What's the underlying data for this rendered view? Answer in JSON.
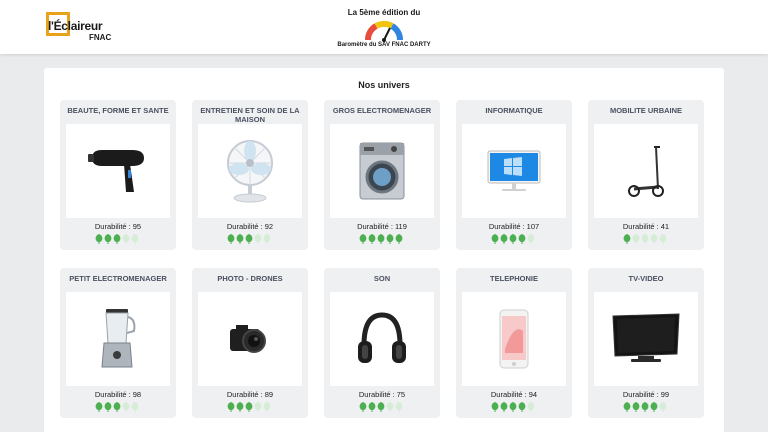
{
  "header": {
    "logo_line1": "l'Éclaireur",
    "logo_line2": "FNAC",
    "barometer_edition": "La 5ème édition du",
    "barometer_title": "Baromètre du SAV FNAC DARTY"
  },
  "main": {
    "title": "Nos univers",
    "durability_label": "Durabilité :",
    "colors": {
      "leaf_on": "#4caf50",
      "leaf_off": "#d6ecd7",
      "brand": "#e8a21b"
    },
    "cards": [
      {
        "title": "BEAUTE, FORME ET SANTE",
        "durability": "95",
        "score": 3,
        "icon": "hair-dryer-icon"
      },
      {
        "title": "ENTRETIEN ET SOIN DE LA MAISON",
        "durability": "92",
        "score": 3,
        "icon": "fan-icon"
      },
      {
        "title": "GROS ELECTROMENAGER",
        "durability": "119",
        "score": 5,
        "icon": "washing-machine-icon"
      },
      {
        "title": "INFORMATIQUE",
        "durability": "107",
        "score": 4,
        "icon": "desktop-computer-icon"
      },
      {
        "title": "MOBILITE URBAINE",
        "durability": "41",
        "score": 1,
        "icon": "scooter-icon"
      },
      {
        "title": "PETIT ELECTROMENAGER",
        "durability": "98",
        "score": 3,
        "icon": "blender-icon"
      },
      {
        "title": "PHOTO - DRONES",
        "durability": "89",
        "score": 3,
        "icon": "camera-icon"
      },
      {
        "title": "SON",
        "durability": "75",
        "score": 3,
        "icon": "headphones-icon"
      },
      {
        "title": "TELEPHONIE",
        "durability": "94",
        "score": 4,
        "icon": "smartphone-icon"
      },
      {
        "title": "TV-VIDEO",
        "durability": "99",
        "score": 4,
        "icon": "television-icon"
      }
    ]
  }
}
